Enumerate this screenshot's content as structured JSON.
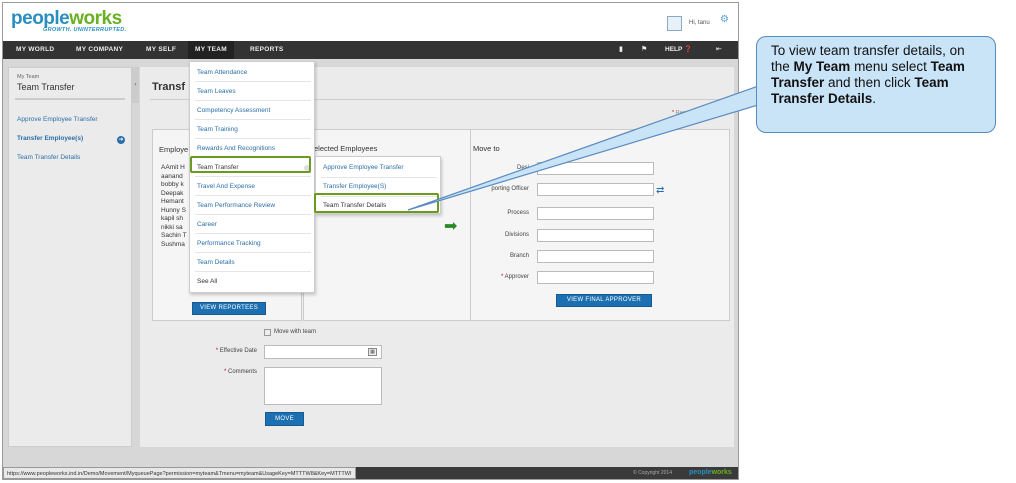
{
  "header": {
    "logo_text_a": "pe",
    "logo_text_b": "ople",
    "logo_text_c": "w",
    "logo_text_d": "rks",
    "tagline": "GROWTH. UNINTERRUPTED.",
    "greeting": "Hi, tanu"
  },
  "nav": {
    "items": [
      "MY WORLD",
      "MY COMPANY",
      "MY SELF",
      "MY TEAM",
      "REPORTS"
    ],
    "help_label": "HELP"
  },
  "sidebar": {
    "crumb": "My Team",
    "title": "Team Transfer",
    "links": [
      "Approve Employee Transfer",
      "Transfer Employee(s)",
      "Team Transfer Details"
    ]
  },
  "main": {
    "title": "Transf",
    "required_note": "Required",
    "employees_box_title": "Employe",
    "employees": [
      "AAmit H",
      "aanand",
      "bobby k",
      "Deepak",
      "Hemant",
      "Hunny S",
      "kapil sh",
      "nikki sa",
      "Sachin T",
      "Sushma"
    ],
    "view_reportees_label": "VIEW REPORTEES",
    "selected_box_title": "elected Employees",
    "move_to_title": "Move to",
    "form_labels": {
      "designation": "Desi",
      "reporting_officer": "porting Officer",
      "process": "Process",
      "divisions": "Divisions",
      "branch": "Branch",
      "approver": "Approver"
    },
    "view_final_approver_label": "VIEW FINAL APPROVER",
    "move_with_team_label": "Move with team",
    "effective_date_label": "Effective Date",
    "comments_label": "Comments",
    "move_label": "MOVE"
  },
  "menu": {
    "items": [
      "Team Attendance",
      "Team Leaves",
      "Competency Assessment",
      "Team Training",
      "Rewards And Recognitions",
      "Team Transfer",
      "Travel And Expense",
      "Team Performance Review",
      "Career",
      "Performance Tracking",
      "Team Details",
      "See All"
    ]
  },
  "submenu": {
    "items": [
      "Approve Employee Transfer",
      "Transfer Employee(S)",
      "Team Transfer Details"
    ]
  },
  "status": {
    "url": "https://www.peopleworks.ind.in/Demo/Movement/MyqueuePage?permission=myteam&Tmenu=myteam&UsageKey=MTTTW8&Key=MTTTWI",
    "copyright": "© Copyright 2014"
  },
  "callout": {
    "line1": "To view team transfer details, on the ",
    "bold1": "My Team",
    "line2": " menu select ",
    "bold2": "Team Transfer",
    "line3": " and then click ",
    "bold3": "Team Transfer Details",
    "line4": "."
  },
  "colors": {
    "accent": "#2a8fc0",
    "link": "#2a6ea8",
    "highlight": "#6a9b1e",
    "nav_bg": "#333333",
    "callout_bg": "#c9e3f7"
  }
}
